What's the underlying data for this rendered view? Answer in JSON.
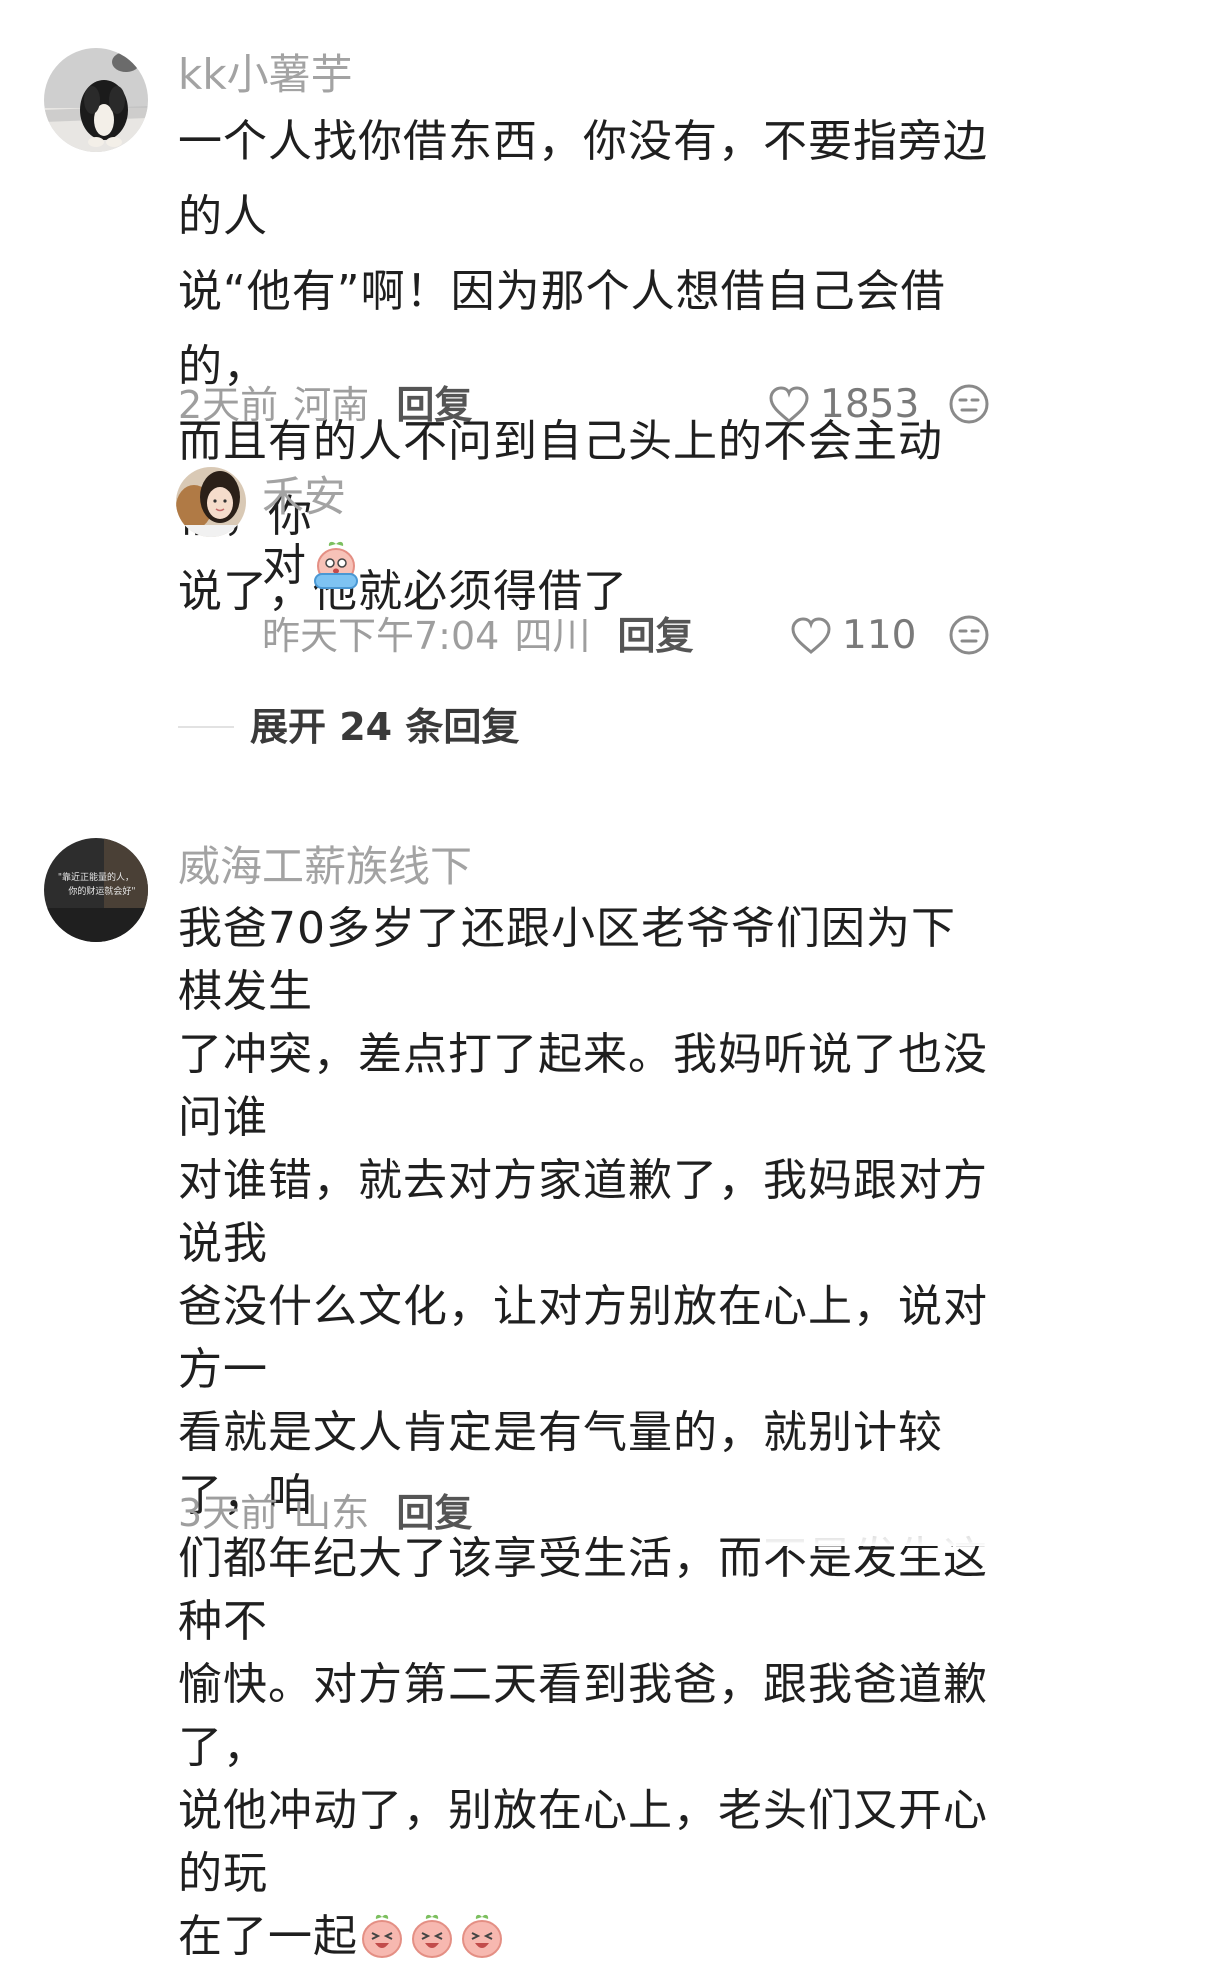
{
  "comments": [
    {
      "username": "kk小薯芋",
      "lines": [
        "一个人找你借东西，你没有，不要指旁边的人",
        "说“他有”啊！因为那个人想借自己会借的，",
        "而且有的人不问到自己头上的不会主动借，你",
        "说了，他就必须得借了"
      ],
      "time": "2天前",
      "location": "河南",
      "reply_label": "回复",
      "likes": "1853",
      "avatar_icon": "dog-photo-avatar"
    },
    {
      "username": "威海工薪族线下",
      "lines": [
        "我爸70多岁了还跟小区老爷爷们因为下棋发生",
        "了冲突，差点打了起来。我妈听说了也没问谁",
        "对谁错，就去对方家道歉了，我妈跟对方说我",
        "爸没什么文化，让对方别放在心上，说对方一",
        "看就是文人肯定是有气量的，就别计较了，咱",
        "们都年纪大了该享受生活，而不是发生这种不",
        "愉快。对方第二天看到我爸，跟我爸道歉了，",
        "说他冲动了，别放在心上，老头们又开心的玩",
        "在了一起"
      ],
      "time": "3天前",
      "location": "山东",
      "reply_label": "回复",
      "avatar_text_line1": "\"靠近正能量的人，",
      "avatar_text_line2": "你的财运就会好\""
    }
  ],
  "subreply": {
    "username": "禾安",
    "text": "对",
    "time": "昨天下午7:04",
    "location": "四川",
    "reply_label": "回复",
    "likes": "110",
    "avatar_icon": "girl-photo-avatar"
  },
  "expand_label": "展开 24 条回复",
  "colors": {
    "text": "#1f1f1f",
    "muted": "#9e9e9e",
    "peach": "#f7b8b0"
  }
}
